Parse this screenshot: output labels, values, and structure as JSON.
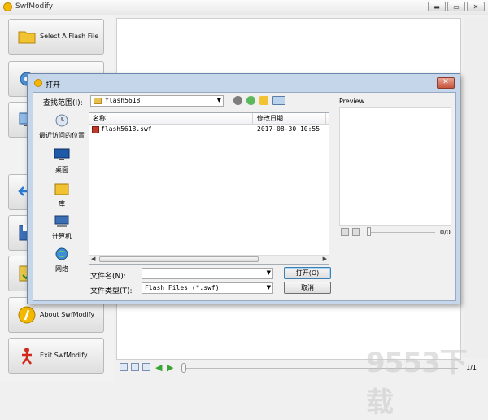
{
  "app": {
    "title": "SwfModify",
    "min": "▬",
    "max": "▭",
    "close": "✕"
  },
  "sidebar": {
    "buttons": [
      {
        "label": "Select A Flash File"
      },
      {
        "label": "About SwfModify"
      },
      {
        "label": "Exit SwfModify"
      }
    ]
  },
  "bottombar": {
    "frame_counter": "1/1"
  },
  "dialog": {
    "title": "打开",
    "close": "✕",
    "look_in_label": "查找范围(I):",
    "look_in_value": "flash5618",
    "places": [
      {
        "label": "最近访问的位置"
      },
      {
        "label": "桌面"
      },
      {
        "label": "库"
      },
      {
        "label": "计算机"
      },
      {
        "label": "网络"
      }
    ],
    "columns": {
      "name": "名称",
      "date": "修改日期"
    },
    "files": [
      {
        "name": "flash5618.swf",
        "date": "2017-08-30 10:55"
      }
    ],
    "file_name_label": "文件名(N):",
    "file_name_value": "",
    "file_type_label": "文件类型(T):",
    "file_type_value": "Flash Files (*.swf)",
    "open_button": "打开(O)",
    "cancel_button": "取消",
    "preview_label": "Preview",
    "preview_counter": "0/0"
  },
  "watermark": "9553下载",
  "colors": {
    "dialog_frame": "#c6d6ea",
    "accent": "#3c7fb1",
    "close_red": "#c7553d"
  }
}
